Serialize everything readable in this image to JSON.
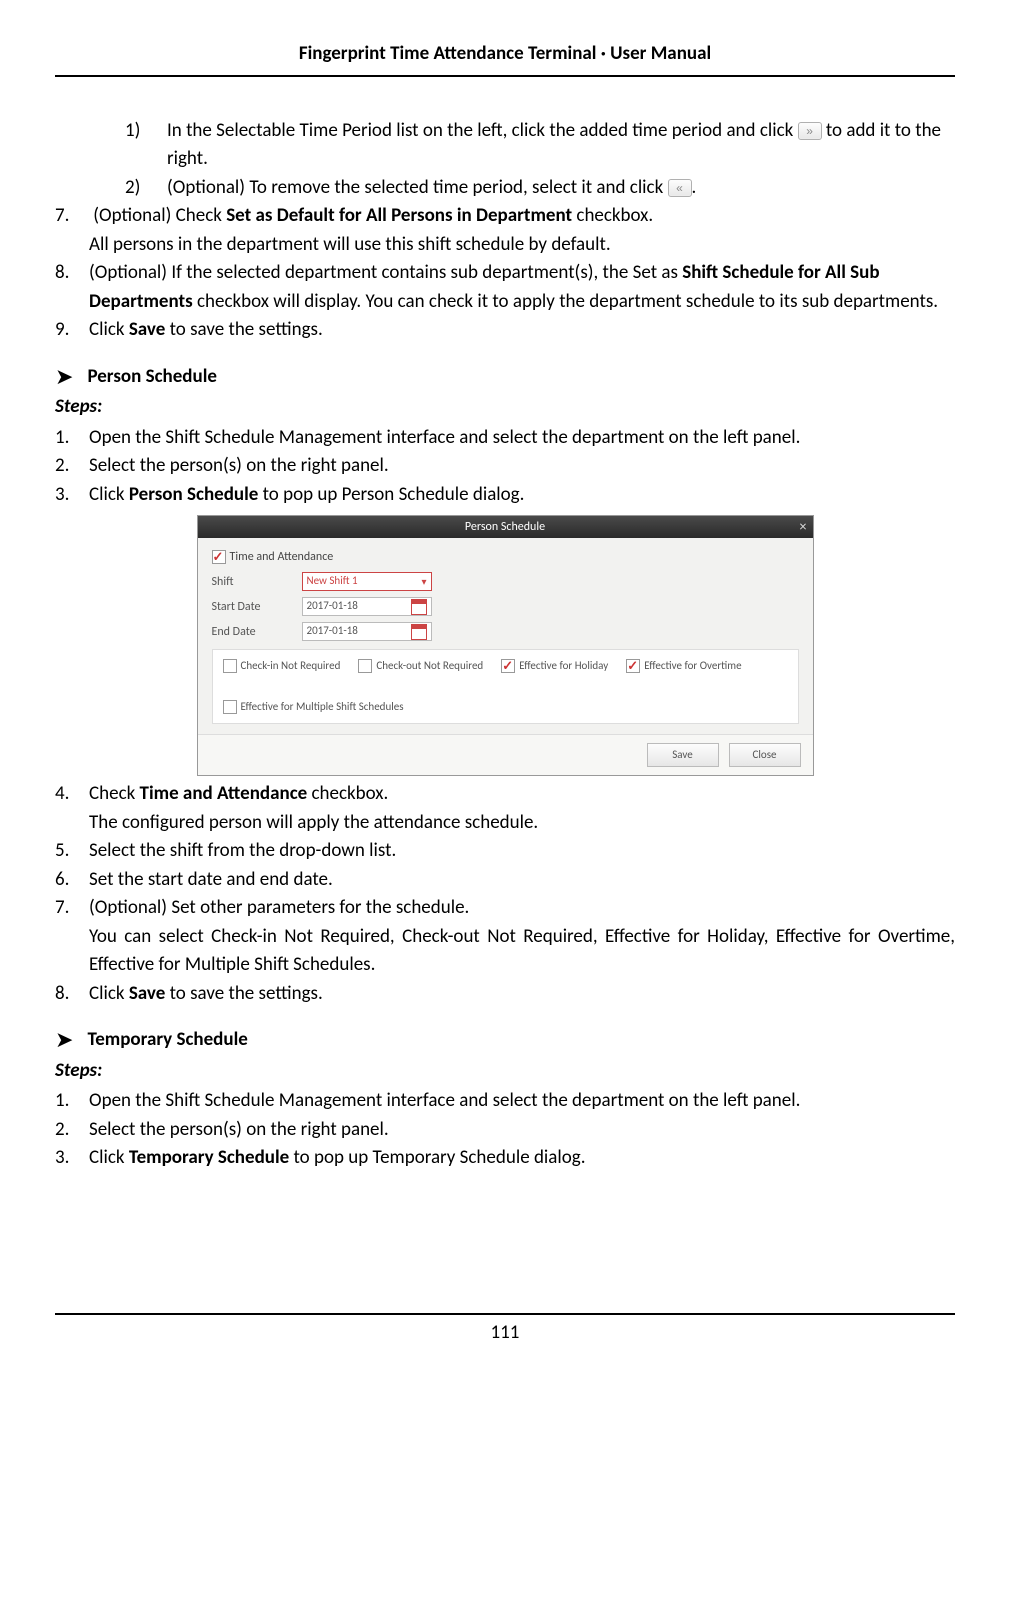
{
  "header_title": "Fingerprint Time Attendance Terminal · User Manual",
  "page_number": "111",
  "sub_1_num": "1)",
  "sub_1_a": "In the Selectable Time Period list on the left, click the added time period and click ",
  "sub_1_b": " to add it to the right.",
  "sub_2_num": "2)",
  "sub_2_a": "(Optional) To remove the selected time period, select it and click ",
  "sub_2_b": ".",
  "s7_num": "7.",
  "s7_a": "(Optional) Check ",
  "s7_bold": "Set as Default for All Persons in Department",
  "s7_b": " checkbox.",
  "s7_line2": "All persons in the department will use this shift schedule by default.",
  "s8_num": "8.",
  "s8_a": "(Optional) If the selected department contains sub department(s), the Set as ",
  "s8_bold": "Shift Schedule for All Sub Departments",
  "s8_b": " checkbox will display. You can check it to apply the department schedule to its sub departments.",
  "s9_num": "9.",
  "s9_a": "Click ",
  "s9_bold": "Save",
  "s9_b": " to save the settings.",
  "section_person_title": "Person Schedule",
  "steps_label": "Steps:",
  "p1_num": "1.",
  "p1_text": "Open the Shift Schedule Management interface and select the department on the left panel.",
  "p2_num": "2.",
  "p2_text": "Select the person(s) on the right panel.",
  "p3_num": "3.",
  "p3_a": "Click ",
  "p3_bold": "Person Schedule",
  "p3_b": " to pop up Person Schedule dialog.",
  "dialog": {
    "title": "Person Schedule",
    "chk_time_attendance": "Time and Attendance",
    "lbl_shift": "Shift",
    "val_shift": "New Shift 1",
    "lbl_start": "Start Date",
    "val_start": "2017-01-18",
    "lbl_end": "End Date",
    "val_end": "2017-01-18",
    "chk_checkin": "Check-in Not Required",
    "chk_checkout": "Check-out Not Required",
    "chk_holiday": "Effective for Holiday",
    "chk_overtime": "Effective for Overtime",
    "chk_multi": "Effective for Multiple Shift Schedules",
    "btn_save": "Save",
    "btn_close": "Close"
  },
  "p4_num": "4.",
  "p4_a": "Check ",
  "p4_bold": "Time and Attendance",
  "p4_b": " checkbox.",
  "p4_line2": "The configured person will apply the attendance schedule.",
  "p5_num": "5.",
  "p5_text": "Select the shift from the drop-down list.",
  "p6_num": "6.",
  "p6_text": "Set the start date and end date.",
  "p7_num": "7.",
  "p7_text": "(Optional) Set other parameters for the schedule.",
  "p7_line2": "You can select Check-in Not Required, Check-out Not Required, Effective for Holiday, Effective for Overtime, Effective for Multiple Shift Schedules.",
  "p8_num": "8.",
  "p8_a": "Click ",
  "p8_bold": "Save",
  "p8_b": " to save the settings.",
  "section_temp_title": "Temporary Schedule",
  "t1_num": "1.",
  "t1_text": "Open the Shift Schedule Management interface and select the department on the left panel.",
  "t2_num": "2.",
  "t2_text": "Select the person(s) on the right panel.",
  "t3_num": "3.",
  "t3_a": "Click ",
  "t3_bold": "Temporary Schedule",
  "t3_b": " to pop up Temporary Schedule dialog."
}
